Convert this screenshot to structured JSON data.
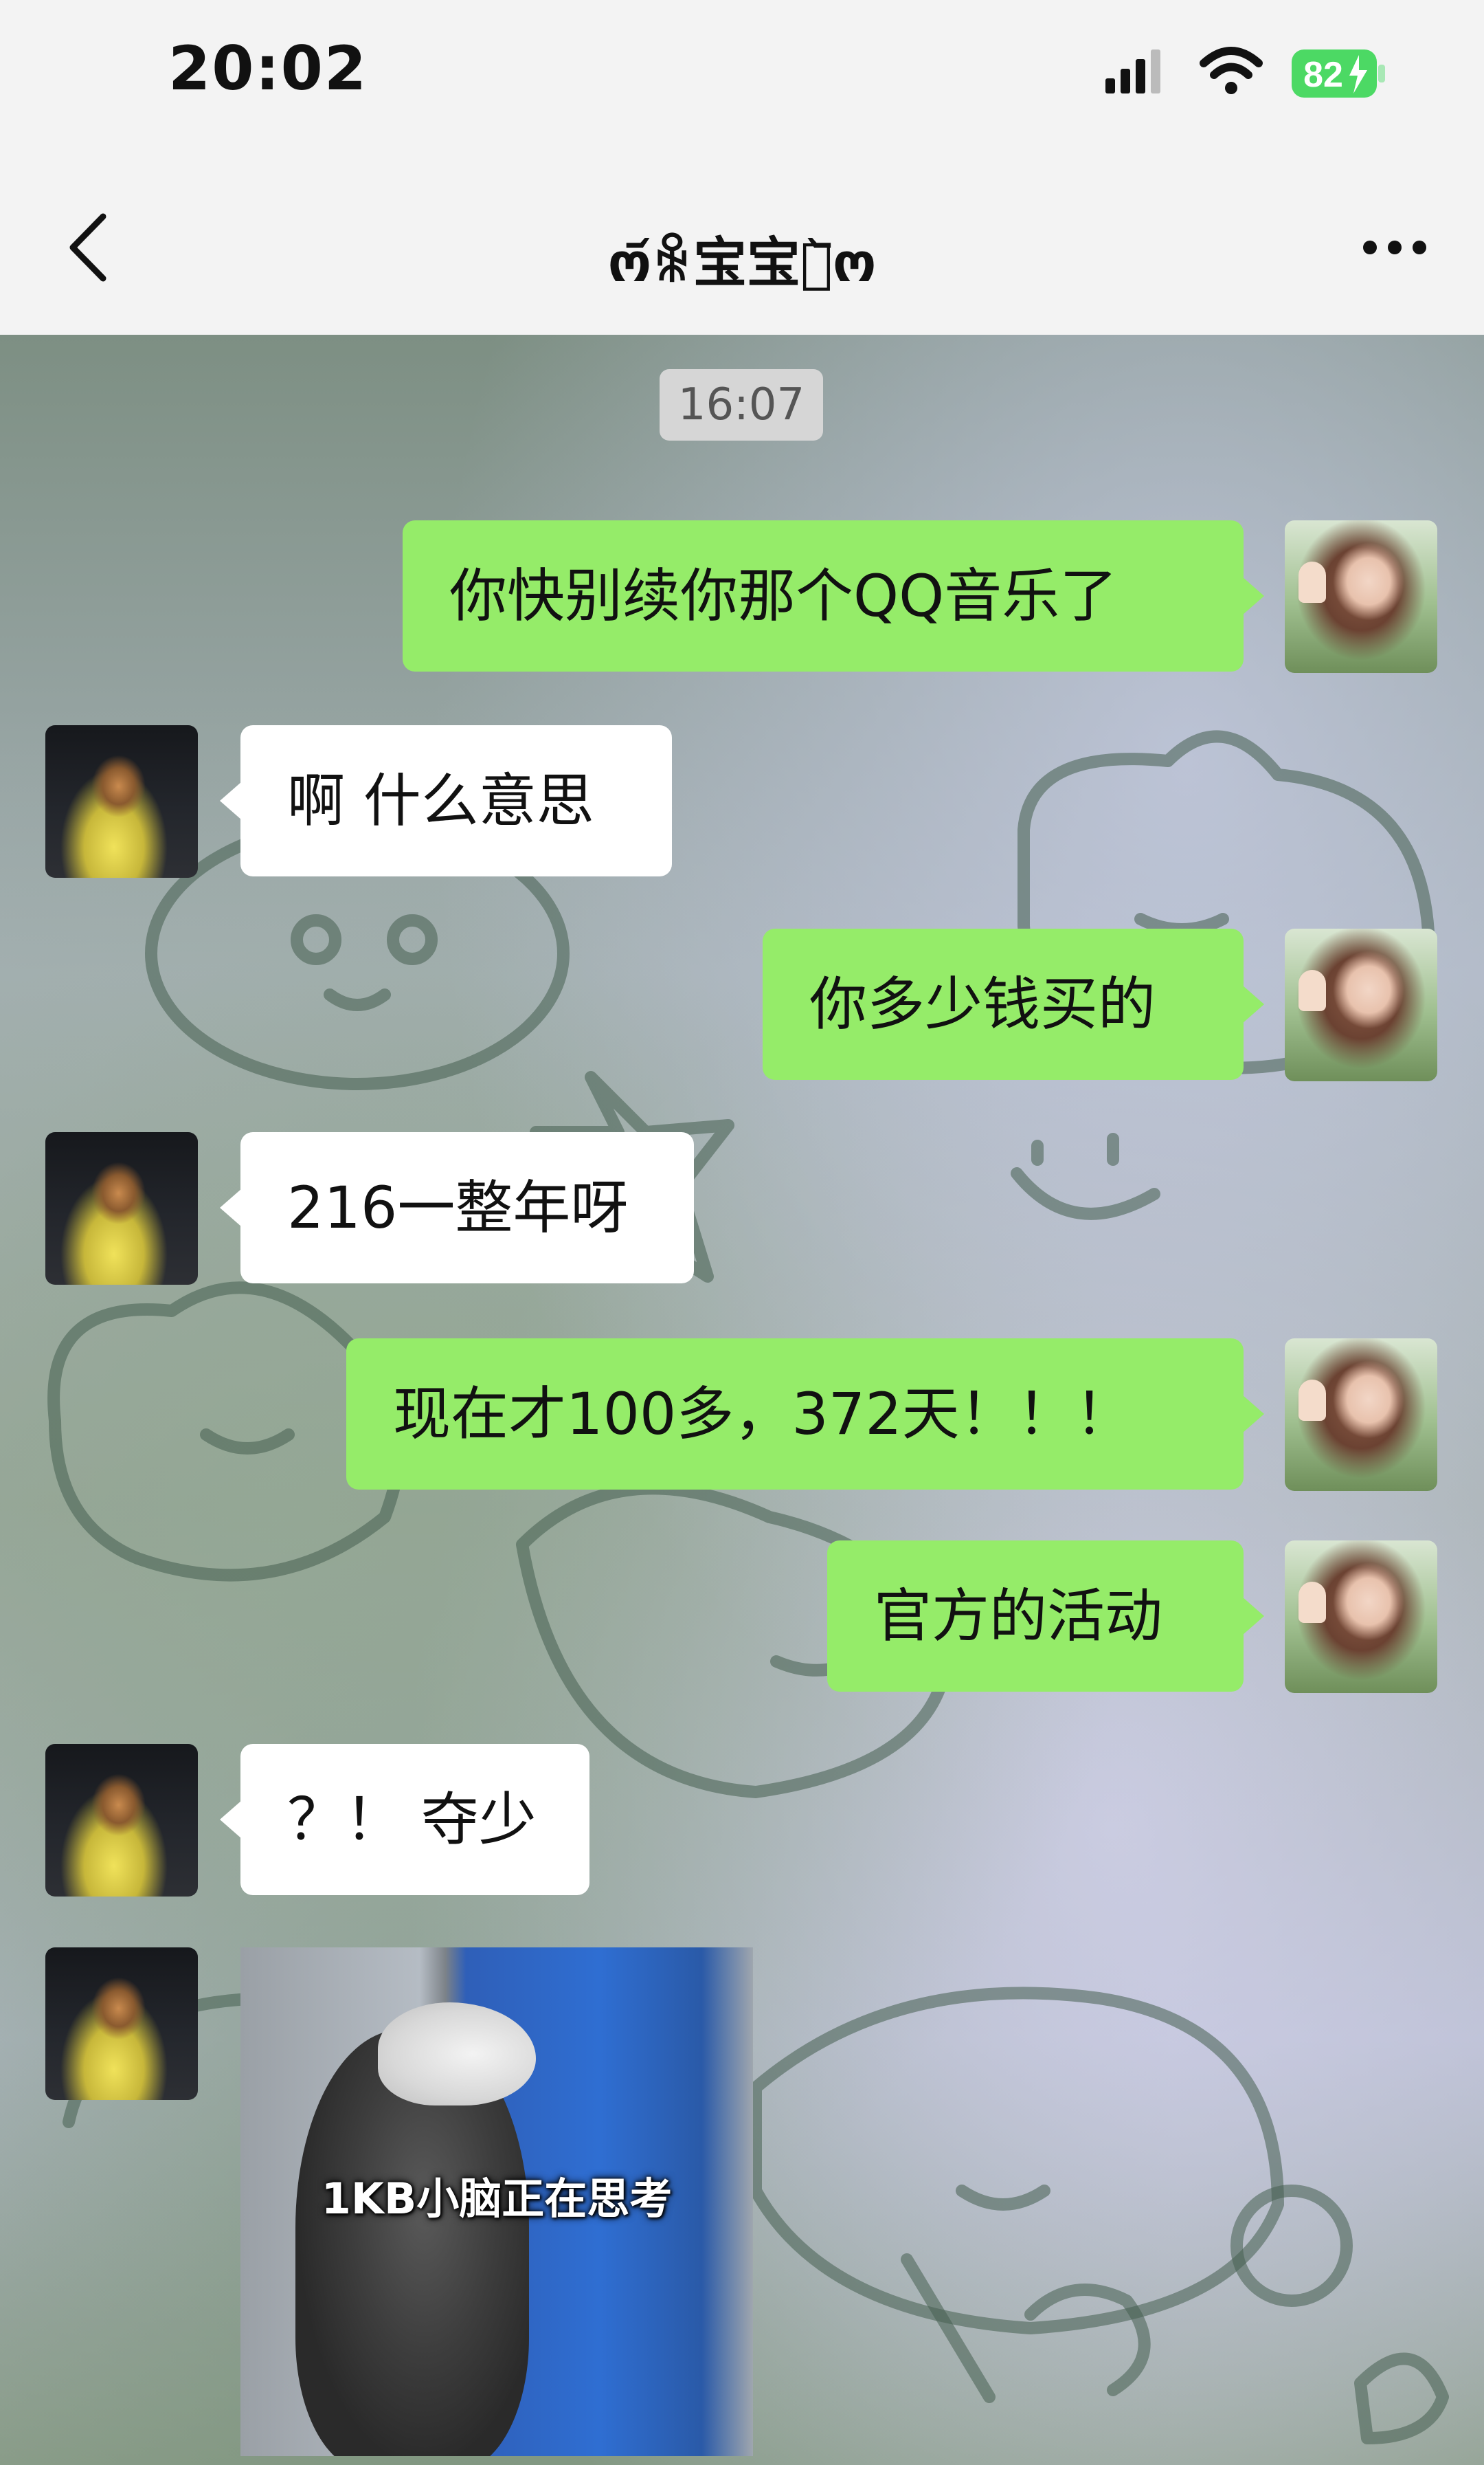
{
  "status_bar": {
    "time": "20:02",
    "battery_level": "82",
    "signal_icon": "cellular-signal-icon",
    "wifi_icon": "wifi-icon",
    "battery_icon": "battery-charging-icon"
  },
  "nav": {
    "back_icon": "chevron-left-icon",
    "title": "ო᷄ꆜ宝宝ꆜ᷅ო",
    "more_icon": "more-horizontal-icon"
  },
  "chat": {
    "timestamp": "16:07",
    "messages": [
      {
        "side": "out",
        "text": "你快别续你那个QQ音乐了"
      },
      {
        "side": "in",
        "text": "啊 什么意思"
      },
      {
        "side": "out",
        "text": "你多少钱买的"
      },
      {
        "side": "in",
        "text": "216一整年呀"
      },
      {
        "side": "out",
        "text": "现在才100多，372天！！！"
      },
      {
        "side": "out",
        "text": "官方的活动"
      },
      {
        "side": "in",
        "text": "？！ 夺少"
      }
    ],
    "sticker": {
      "caption": "1KB小脑正在思考"
    }
  },
  "colors": {
    "outgoing_bubble": "#95ec69",
    "incoming_bubble": "#ffffff",
    "bar_background": "#f3f3f3",
    "battery_green": "#4cd964"
  }
}
